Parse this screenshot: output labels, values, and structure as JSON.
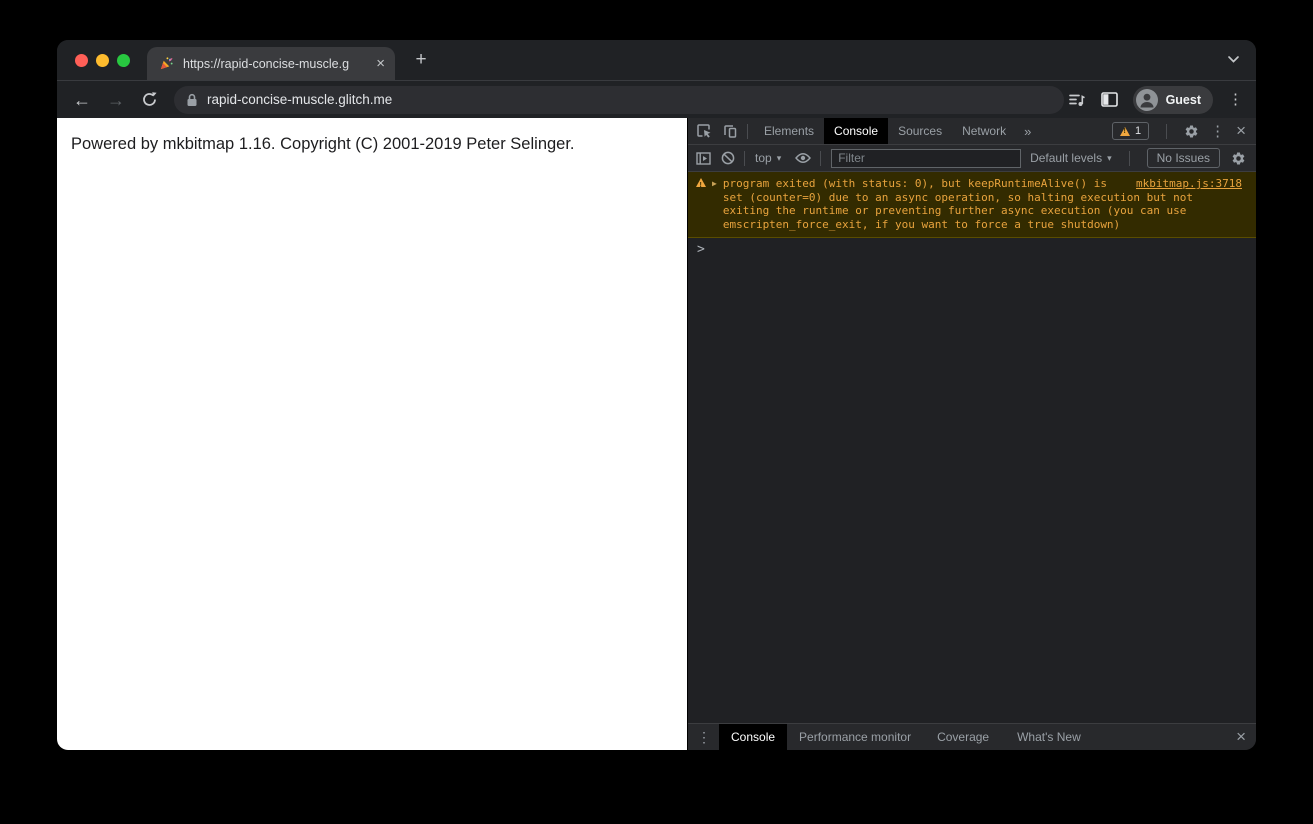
{
  "browser": {
    "tab": {
      "title": "https://rapid-concise-muscle.g",
      "close_glyph": "×"
    },
    "new_tab_glyph": "+",
    "toolbar": {
      "back_glyph": "←",
      "forward_glyph": "→",
      "url": "rapid-concise-muscle.glitch.me",
      "guest_label": "Guest",
      "menu_glyph": "⋮"
    }
  },
  "page": {
    "text": "Powered by mkbitmap 1.16. Copyright (C) 2001-2019 Peter Selinger."
  },
  "devtools": {
    "tabs": [
      "Elements",
      "Console",
      "Sources",
      "Network"
    ],
    "active_tab": "Console",
    "more_tabs_glyph": "»",
    "warning_count": "1",
    "menu_glyph": "⋮",
    "close_glyph": "×",
    "console_toolbar": {
      "context_label": "top",
      "caret_glyph": "▾",
      "filter_placeholder": "Filter",
      "levels_label": "Default levels",
      "issues_label": "No Issues"
    },
    "console": {
      "expand_glyph": "▶",
      "warning_message": "program exited (with status: 0), but keepRuntimeAlive() is set (counter=0) due to an async operation, so halting execution but not exiting the runtime or preventing further async execution (you can use emscripten_force_exit, if you want to force a true shutdown)",
      "warning_source": "mkbitmap.js:3718",
      "prompt_glyph": ">"
    },
    "drawer": {
      "tabs": [
        "Console",
        "Performance monitor",
        "Coverage",
        "What's New"
      ],
      "active_tab": "Console",
      "menu_glyph": "⋮",
      "close_glyph": "×"
    }
  },
  "colors": {
    "traffic_red": "#ff5f57",
    "traffic_yellow": "#febc2e",
    "traffic_green": "#28c840",
    "chrome_frame": "#202225",
    "active_tab": "#3a3b3e",
    "omnibox": "#2d2e32",
    "devtools_bg": "#202124",
    "devtools_bar": "#28292c",
    "warning_bg": "#332b00",
    "warning_text": "#e8a33d"
  }
}
